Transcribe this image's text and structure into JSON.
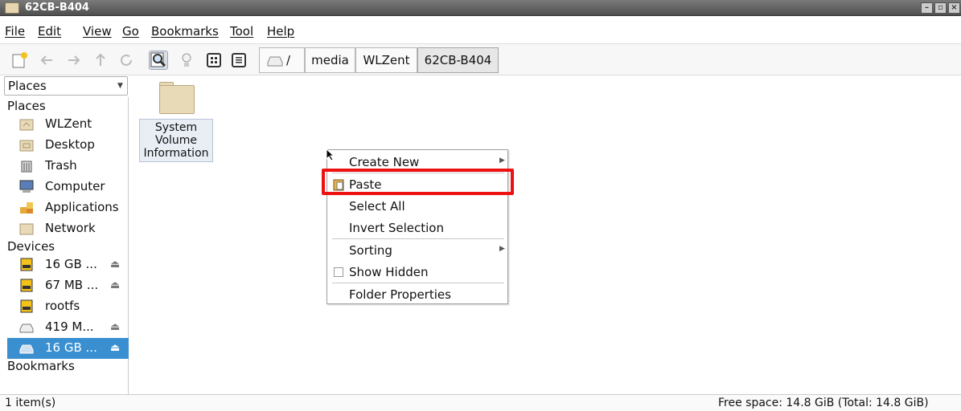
{
  "window": {
    "title": "62CB-B404"
  },
  "menubar": {
    "items": [
      "File",
      "Edit",
      "View",
      "Go",
      "Bookmarks",
      "Tool",
      "Help"
    ]
  },
  "toolbar": {
    "path": [
      "media",
      "WLZent",
      "62CB-B404"
    ],
    "root": "/"
  },
  "sidebar": {
    "dropdown": "Places",
    "sections": {
      "places": "Places",
      "devices": "Devices",
      "bookmarks": "Bookmarks"
    },
    "places": [
      "WLZent",
      "Desktop",
      "Trash",
      "Computer",
      "Applications",
      "Network"
    ],
    "devices": [
      "16 GB ...",
      "67 MB ...",
      "rootfs",
      "419 M...",
      "16 GB ..."
    ],
    "selected_device": "16 GB ..."
  },
  "files": [
    {
      "name_lines": [
        "System",
        "Volume",
        "Information"
      ]
    }
  ],
  "context_menu": {
    "create_new": "Create New",
    "paste": "Paste",
    "select_all": "Select All",
    "invert_selection": "Invert Selection",
    "sorting": "Sorting",
    "show_hidden": "Show Hidden",
    "folder_properties": "Folder Properties"
  },
  "status": {
    "items": "1 item(s)",
    "free_space": "Free space: 14.8 GiB (Total: 14.8 GiB)"
  }
}
